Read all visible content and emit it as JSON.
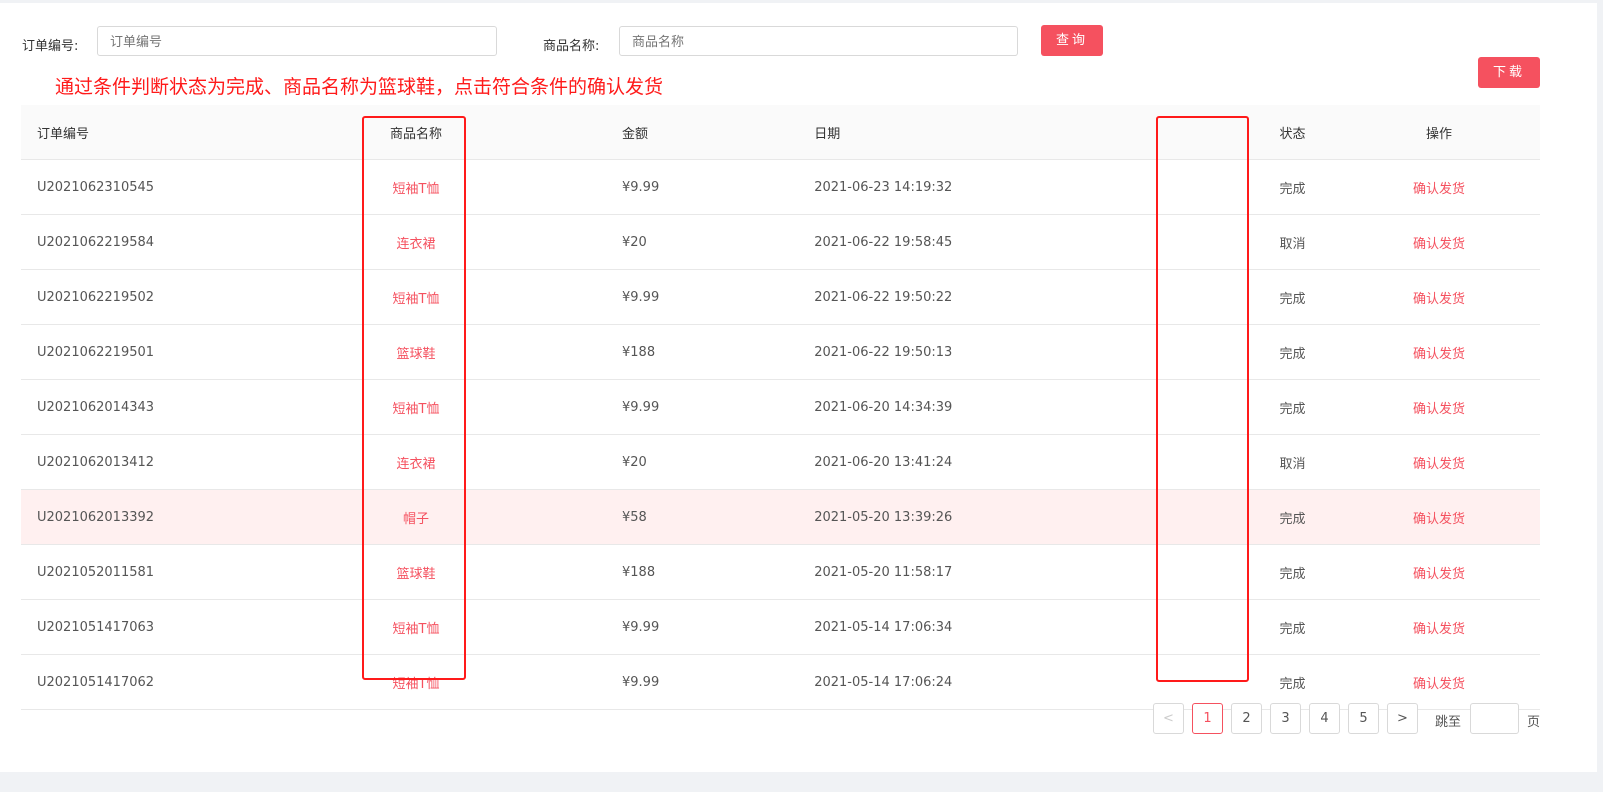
{
  "search": {
    "order_label": "订单编号:",
    "order_placeholder": "订单编号",
    "product_label": "商品名称:",
    "product_placeholder": "商品名称",
    "query_label": "查询"
  },
  "download_label": "下载",
  "instruction": "通过条件判断状态为完成、商品名称为篮球鞋，点击符合条件的确认发货",
  "table": {
    "headers": [
      "订单编号",
      "商品名称",
      "金额",
      "日期",
      "状态",
      "操作"
    ],
    "rows": [
      {
        "id": "U2021062310545",
        "product": "短袖T恤",
        "amount": "¥9.99",
        "date": "2021-06-23 14:19:32",
        "status": "完成",
        "action": "确认发货"
      },
      {
        "id": "U2021062219584",
        "product": "连衣裙",
        "amount": "¥20",
        "date": "2021-06-22 19:58:45",
        "status": "取消",
        "action": "确认发货"
      },
      {
        "id": "U2021062219502",
        "product": "短袖T恤",
        "amount": "¥9.99",
        "date": "2021-06-22 19:50:22",
        "status": "完成",
        "action": "确认发货"
      },
      {
        "id": "U2021062219501",
        "product": "篮球鞋",
        "amount": "¥188",
        "date": "2021-06-22 19:50:13",
        "status": "完成",
        "action": "确认发货"
      },
      {
        "id": "U2021062014343",
        "product": "短袖T恤",
        "amount": "¥9.99",
        "date": "2021-06-20 14:34:39",
        "status": "完成",
        "action": "确认发货"
      },
      {
        "id": "U2021062013412",
        "product": "连衣裙",
        "amount": "¥20",
        "date": "2021-06-20 13:41:24",
        "status": "取消",
        "action": "确认发货"
      },
      {
        "id": "U2021062013392",
        "product": "帽子",
        "amount": "¥58",
        "date": "2021-05-20 13:39:26",
        "status": "完成",
        "action": "确认发货"
      },
      {
        "id": "U2021052011581",
        "product": "篮球鞋",
        "amount": "¥188",
        "date": "2021-05-20 11:58:17",
        "status": "完成",
        "action": "确认发货"
      },
      {
        "id": "U2021051417063",
        "product": "短袖T恤",
        "amount": "¥9.99",
        "date": "2021-05-14 17:06:34",
        "status": "完成",
        "action": "确认发货"
      },
      {
        "id": "U2021051417062",
        "product": "短袖T恤",
        "amount": "¥9.99",
        "date": "2021-05-14 17:06:24",
        "status": "完成",
        "action": "确认发货"
      }
    ]
  },
  "pagination": {
    "prev": "<",
    "pages": [
      "1",
      "2",
      "3",
      "4",
      "5"
    ],
    "next": ">",
    "jump_label": "跳至",
    "page_suffix": "页",
    "current": "1"
  }
}
